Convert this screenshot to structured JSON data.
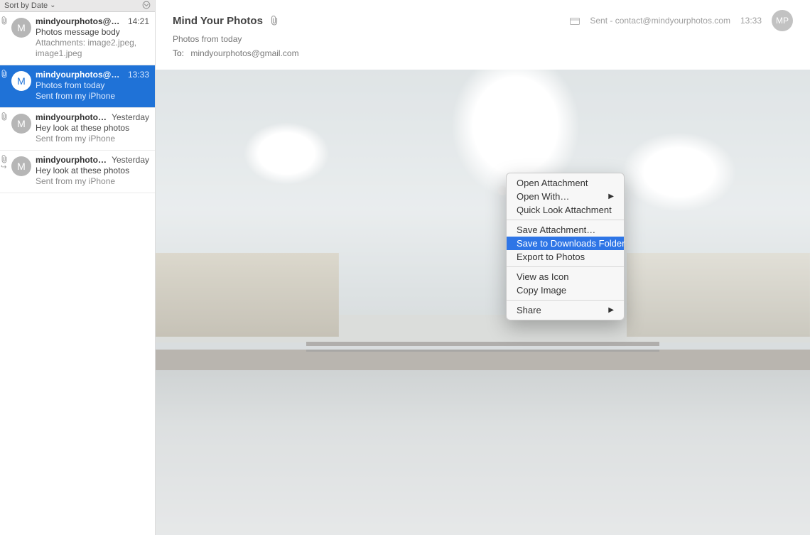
{
  "sidebar": {
    "sort_label": "Sort by Date",
    "messages": [
      {
        "initial": "M",
        "sender": "mindyourphotos@gmail.c…",
        "time": "14:21",
        "subject": "Photos message body",
        "preview": "Attachments: image2.jpeg, image1.jpeg",
        "has_attachment": true,
        "has_reply": false,
        "selected": false
      },
      {
        "initial": "M",
        "sender": "mindyourphotos@gmail.…",
        "time": "13:33",
        "subject": "Photos from today",
        "preview": "Sent from my iPhone",
        "has_attachment": true,
        "has_reply": false,
        "selected": true
      },
      {
        "initial": "M",
        "sender": "mindyourphotos@ya…",
        "time": "Yesterday",
        "subject": "Hey look at these photos",
        "preview": "Sent from my iPhone",
        "has_attachment": true,
        "has_reply": false,
        "selected": false
      },
      {
        "initial": "M",
        "sender": "mindyourphotos@ya…",
        "time": "Yesterday",
        "subject": "Hey look at these photos",
        "preview": "Sent from my iPhone",
        "has_attachment": true,
        "has_reply": true,
        "selected": false
      }
    ]
  },
  "header": {
    "from_display": "Mind Your Photos",
    "subject": "Photos from today",
    "to_label": "To:",
    "to_value": "mindyourphotos@gmail.com",
    "folder_label": "Sent - contact@mindyourphotos.com",
    "time": "13:33",
    "avatar_initials": "MP"
  },
  "context_menu": {
    "items": [
      {
        "label": "Open Attachment",
        "submenu": false
      },
      {
        "label": "Open With…",
        "submenu": true
      },
      {
        "label": "Quick Look Attachment",
        "submenu": false
      },
      {
        "separator": true
      },
      {
        "label": "Save Attachment…",
        "submenu": false
      },
      {
        "label": "Save to Downloads Folder",
        "submenu": false,
        "highlight": true
      },
      {
        "label": "Export to Photos",
        "submenu": false
      },
      {
        "separator": true
      },
      {
        "label": "View as Icon",
        "submenu": false
      },
      {
        "label": "Copy Image",
        "submenu": false
      },
      {
        "separator": true
      },
      {
        "label": "Share",
        "submenu": true
      }
    ]
  }
}
